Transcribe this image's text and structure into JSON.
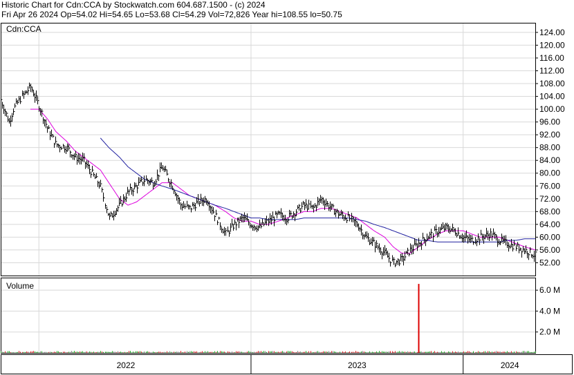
{
  "header": {
    "line1": "Historic Chart for Cdn:CCA by Stockwatch.com 604.687.1500 - (c) 2024",
    "line2": "Fri Apr 26 2024   Op=54.02   Hi=54.65   Lo=53.68   Cl=54.29   Vol=72,826   Year hi=108.55   lo=50.75"
  },
  "chart_data": [
    {
      "type": "line",
      "panel": "price",
      "label": "Cdn:CCA",
      "ylim": [
        48,
        127
      ],
      "y_ticks": [
        "52.00",
        "56.00",
        "60.00",
        "64.00",
        "68.00",
        "72.00",
        "76.00",
        "80.00",
        "84.00",
        "88.00",
        "92.00",
        "96.00",
        "100.00",
        "104.00",
        "108.00",
        "112.00",
        "116.00",
        "120.00",
        "124.00"
      ],
      "y_tick_values": [
        52,
        56,
        60,
        64,
        68,
        72,
        76,
        80,
        84,
        88,
        92,
        96,
        100,
        104,
        108,
        112,
        116,
        120,
        124
      ],
      "x_labels": [
        "2022",
        "2023",
        "2024"
      ],
      "x_range": [
        2021.82,
        2024.34
      ],
      "year_boundaries": [
        2022.0,
        2023.0,
        2024.0
      ],
      "series": [
        {
          "name": "",
          "style": "price-bars",
          "color": "#000000",
          "x": [
            2021.82,
            2021.86,
            2021.88,
            2021.92,
            2021.96,
            2022.0,
            2022.04,
            2022.08,
            2022.13,
            2022.17,
            2022.21,
            2022.25,
            2022.29,
            2022.33,
            2022.38,
            2022.42,
            2022.46,
            2022.5,
            2022.54,
            2022.58,
            2022.63,
            2022.67,
            2022.71,
            2022.75,
            2022.79,
            2022.83,
            2022.88,
            2022.92,
            2022.96,
            2023.0,
            2023.04,
            2023.08,
            2023.13,
            2023.17,
            2023.21,
            2023.25,
            2023.29,
            2023.33,
            2023.38,
            2023.42,
            2023.46,
            2023.5,
            2023.54,
            2023.58,
            2023.63,
            2023.67,
            2023.71,
            2023.75,
            2023.79,
            2023.83,
            2023.88,
            2023.92,
            2023.96,
            2024.0,
            2024.04,
            2024.08,
            2024.13,
            2024.17,
            2024.21,
            2024.25,
            2024.29,
            2024.34
          ],
          "values": [
            103,
            96,
            100,
            104,
            107,
            101,
            94,
            89,
            88,
            85,
            84,
            80,
            76,
            66,
            70,
            74,
            76,
            78,
            77,
            82,
            76,
            70,
            69,
            71,
            72,
            67,
            61,
            64,
            66,
            64,
            63,
            65,
            67,
            66,
            68,
            70,
            69,
            72,
            69,
            67,
            66,
            64,
            60,
            58,
            55,
            52,
            53,
            56,
            58,
            60,
            62,
            63,
            62,
            60,
            59,
            60,
            61,
            59,
            58,
            57,
            56,
            54.29
          ],
          "high": [
            104,
            98,
            102,
            105,
            108.55,
            103,
            96,
            91,
            90,
            87,
            86,
            82,
            78,
            68,
            72,
            76,
            78,
            80,
            79,
            83,
            78,
            72,
            71,
            73,
            74,
            69,
            63,
            66,
            68,
            66,
            65,
            67,
            69,
            68,
            70,
            73,
            71,
            74,
            71,
            69,
            68,
            66,
            62,
            60,
            57,
            54,
            55,
            58,
            60,
            62,
            64,
            64,
            63,
            62,
            61,
            62,
            62,
            61,
            60,
            59,
            57,
            54.65
          ],
          "low": [
            101,
            94,
            98,
            102,
            105,
            99,
            92,
            87,
            86,
            83,
            82,
            78,
            74,
            63,
            68,
            72,
            74,
            76,
            75,
            79,
            74,
            68,
            67,
            69,
            70,
            65,
            59,
            62,
            64,
            62,
            61,
            63,
            65,
            64,
            66,
            68,
            67,
            70,
            67,
            65,
            64,
            62,
            58,
            56,
            53,
            50.75,
            51,
            54,
            56,
            58,
            60,
            61,
            60,
            58,
            57,
            58,
            59,
            57,
            56,
            55,
            54,
            53.68
          ]
        },
        {
          "name": "",
          "style": "moving-average",
          "color": "#dd00dd",
          "x": [
            2021.96,
            2022.0,
            2022.04,
            2022.08,
            2022.13,
            2022.17,
            2022.21,
            2022.25,
            2022.29,
            2022.33,
            2022.38,
            2022.42,
            2022.46,
            2022.5,
            2022.54,
            2022.58,
            2022.63,
            2022.67,
            2022.71,
            2022.75,
            2022.79,
            2022.83,
            2022.88,
            2022.92,
            2022.96,
            2023.0,
            2023.04,
            2023.08,
            2023.13,
            2023.17,
            2023.21,
            2023.25,
            2023.29,
            2023.33,
            2023.38,
            2023.42,
            2023.46,
            2023.5,
            2023.54,
            2023.58,
            2023.63,
            2023.67,
            2023.71,
            2023.75,
            2023.79,
            2023.83,
            2023.88,
            2023.92,
            2023.96,
            2024.0,
            2024.04,
            2024.08,
            2024.13,
            2024.17,
            2024.21,
            2024.25,
            2024.29,
            2024.34
          ],
          "values": [
            100,
            100,
            97,
            93,
            90,
            87,
            85,
            83,
            81,
            77,
            72,
            70,
            71,
            73,
            75,
            77,
            77,
            75,
            73,
            72,
            71,
            70,
            68,
            66,
            65,
            65,
            64,
            64,
            65,
            66,
            67,
            68,
            68,
            69,
            69,
            68,
            67,
            66,
            64,
            62,
            60,
            57,
            55,
            55,
            57,
            59,
            61,
            62,
            62,
            62,
            61,
            60,
            60,
            60,
            59,
            58,
            57,
            56
          ]
        },
        {
          "name": "",
          "style": "moving-average",
          "color": "#2020a0",
          "x": [
            2022.29,
            2022.33,
            2022.38,
            2022.42,
            2022.46,
            2022.5,
            2022.54,
            2022.58,
            2022.63,
            2022.67,
            2022.71,
            2022.75,
            2022.79,
            2022.83,
            2022.88,
            2022.92,
            2022.96,
            2023.0,
            2023.04,
            2023.08,
            2023.13,
            2023.17,
            2023.21,
            2023.25,
            2023.29,
            2023.33,
            2023.38,
            2023.42,
            2023.46,
            2023.5,
            2023.54,
            2023.58,
            2023.63,
            2023.67,
            2023.71,
            2023.75,
            2023.79,
            2023.83,
            2023.88,
            2023.92,
            2023.96,
            2024.0,
            2024.04,
            2024.08,
            2024.13,
            2024.17,
            2024.21,
            2024.25,
            2024.29,
            2024.34
          ],
          "values": [
            91,
            88,
            85,
            82,
            80,
            78,
            77,
            76,
            75,
            74,
            73,
            72,
            71,
            70,
            69,
            68,
            67,
            66,
            66,
            65.5,
            65.5,
            65.5,
            65.5,
            66,
            66,
            66,
            66,
            66,
            66,
            65.5,
            65,
            64,
            63,
            62,
            61,
            60,
            59,
            59,
            58.5,
            58.5,
            58.5,
            58.5,
            58.5,
            58.5,
            58.5,
            58.5,
            59,
            59,
            59.5,
            59.5
          ]
        }
      ]
    },
    {
      "type": "bar",
      "panel": "volume",
      "label": "Volume",
      "ylim": [
        0,
        7200000
      ],
      "y_ticks": [
        "2.0 M",
        "4.0 M",
        "6.0 M"
      ],
      "y_tick_values": [
        2000000,
        4000000,
        6000000
      ],
      "x_range": [
        2021.82,
        2024.34
      ],
      "typical_volume": 90000,
      "spike": {
        "x": 2023.79,
        "value": 6600000,
        "color": "#dd0000"
      }
    }
  ]
}
